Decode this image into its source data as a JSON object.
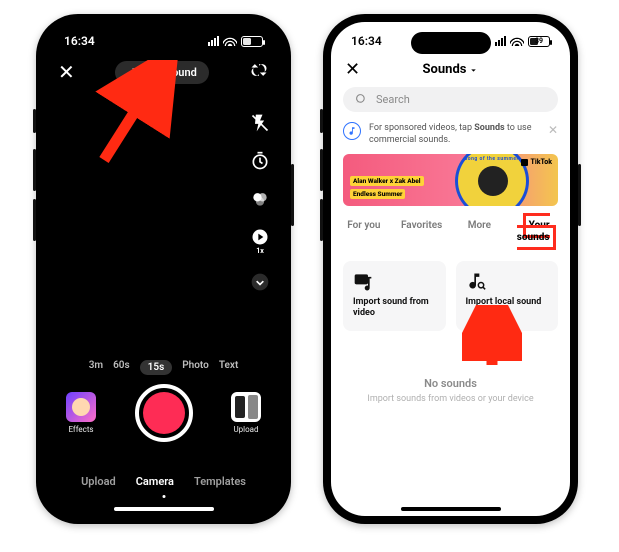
{
  "status": {
    "time": "16:34",
    "battery": "39"
  },
  "camera": {
    "add_sound": "Add sound",
    "durations": [
      "3m",
      "60s",
      "15s",
      "Photo",
      "Text"
    ],
    "selected_duration_index": 2,
    "effects": "Effects",
    "upload": "Upload",
    "speed_label": "1x",
    "modes": [
      "Upload",
      "Camera",
      "Templates"
    ],
    "selected_mode_index": 1
  },
  "sounds": {
    "title": "Sounds",
    "search_placeholder": "Search",
    "tip": {
      "prefix": "For sponsored videos, tap ",
      "bold": "Sounds",
      "suffix": " to use commercial sounds."
    },
    "promo": {
      "badge1": "Alan Walker x Zak Abel",
      "badge2": "Endless Summer",
      "ring_text": "song of the summer",
      "logo": "TikTok"
    },
    "tabs": [
      "For you",
      "Favorites",
      "More",
      "Your sounds"
    ],
    "selected_tab_index": 3,
    "card_import_video": "Import sound from video",
    "card_import_local": "Import local sound",
    "empty_title": "No sounds",
    "empty_sub": "Import sounds from videos or your device"
  }
}
